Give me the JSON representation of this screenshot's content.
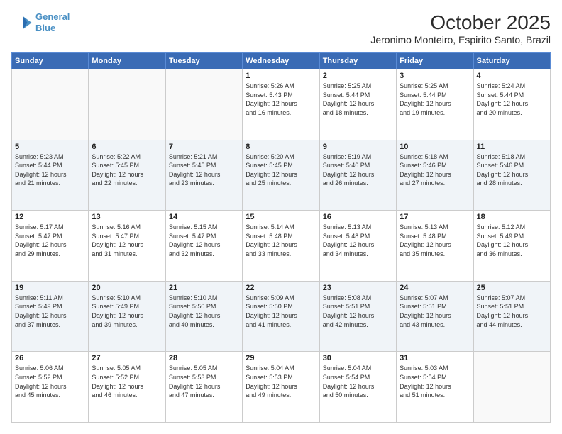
{
  "header": {
    "logo_line1": "General",
    "logo_line2": "Blue",
    "month": "October 2025",
    "location": "Jeronimo Monteiro, Espirito Santo, Brazil"
  },
  "weekdays": [
    "Sunday",
    "Monday",
    "Tuesday",
    "Wednesday",
    "Thursday",
    "Friday",
    "Saturday"
  ],
  "weeks": [
    [
      {
        "day": "",
        "info": ""
      },
      {
        "day": "",
        "info": ""
      },
      {
        "day": "",
        "info": ""
      },
      {
        "day": "1",
        "info": "Sunrise: 5:26 AM\nSunset: 5:43 PM\nDaylight: 12 hours\nand 16 minutes."
      },
      {
        "day": "2",
        "info": "Sunrise: 5:25 AM\nSunset: 5:44 PM\nDaylight: 12 hours\nand 18 minutes."
      },
      {
        "day": "3",
        "info": "Sunrise: 5:25 AM\nSunset: 5:44 PM\nDaylight: 12 hours\nand 19 minutes."
      },
      {
        "day": "4",
        "info": "Sunrise: 5:24 AM\nSunset: 5:44 PM\nDaylight: 12 hours\nand 20 minutes."
      }
    ],
    [
      {
        "day": "5",
        "info": "Sunrise: 5:23 AM\nSunset: 5:44 PM\nDaylight: 12 hours\nand 21 minutes."
      },
      {
        "day": "6",
        "info": "Sunrise: 5:22 AM\nSunset: 5:45 PM\nDaylight: 12 hours\nand 22 minutes."
      },
      {
        "day": "7",
        "info": "Sunrise: 5:21 AM\nSunset: 5:45 PM\nDaylight: 12 hours\nand 23 minutes."
      },
      {
        "day": "8",
        "info": "Sunrise: 5:20 AM\nSunset: 5:45 PM\nDaylight: 12 hours\nand 25 minutes."
      },
      {
        "day": "9",
        "info": "Sunrise: 5:19 AM\nSunset: 5:46 PM\nDaylight: 12 hours\nand 26 minutes."
      },
      {
        "day": "10",
        "info": "Sunrise: 5:18 AM\nSunset: 5:46 PM\nDaylight: 12 hours\nand 27 minutes."
      },
      {
        "day": "11",
        "info": "Sunrise: 5:18 AM\nSunset: 5:46 PM\nDaylight: 12 hours\nand 28 minutes."
      }
    ],
    [
      {
        "day": "12",
        "info": "Sunrise: 5:17 AM\nSunset: 5:47 PM\nDaylight: 12 hours\nand 29 minutes."
      },
      {
        "day": "13",
        "info": "Sunrise: 5:16 AM\nSunset: 5:47 PM\nDaylight: 12 hours\nand 31 minutes."
      },
      {
        "day": "14",
        "info": "Sunrise: 5:15 AM\nSunset: 5:47 PM\nDaylight: 12 hours\nand 32 minutes."
      },
      {
        "day": "15",
        "info": "Sunrise: 5:14 AM\nSunset: 5:48 PM\nDaylight: 12 hours\nand 33 minutes."
      },
      {
        "day": "16",
        "info": "Sunrise: 5:13 AM\nSunset: 5:48 PM\nDaylight: 12 hours\nand 34 minutes."
      },
      {
        "day": "17",
        "info": "Sunrise: 5:13 AM\nSunset: 5:48 PM\nDaylight: 12 hours\nand 35 minutes."
      },
      {
        "day": "18",
        "info": "Sunrise: 5:12 AM\nSunset: 5:49 PM\nDaylight: 12 hours\nand 36 minutes."
      }
    ],
    [
      {
        "day": "19",
        "info": "Sunrise: 5:11 AM\nSunset: 5:49 PM\nDaylight: 12 hours\nand 37 minutes."
      },
      {
        "day": "20",
        "info": "Sunrise: 5:10 AM\nSunset: 5:49 PM\nDaylight: 12 hours\nand 39 minutes."
      },
      {
        "day": "21",
        "info": "Sunrise: 5:10 AM\nSunset: 5:50 PM\nDaylight: 12 hours\nand 40 minutes."
      },
      {
        "day": "22",
        "info": "Sunrise: 5:09 AM\nSunset: 5:50 PM\nDaylight: 12 hours\nand 41 minutes."
      },
      {
        "day": "23",
        "info": "Sunrise: 5:08 AM\nSunset: 5:51 PM\nDaylight: 12 hours\nand 42 minutes."
      },
      {
        "day": "24",
        "info": "Sunrise: 5:07 AM\nSunset: 5:51 PM\nDaylight: 12 hours\nand 43 minutes."
      },
      {
        "day": "25",
        "info": "Sunrise: 5:07 AM\nSunset: 5:51 PM\nDaylight: 12 hours\nand 44 minutes."
      }
    ],
    [
      {
        "day": "26",
        "info": "Sunrise: 5:06 AM\nSunset: 5:52 PM\nDaylight: 12 hours\nand 45 minutes."
      },
      {
        "day": "27",
        "info": "Sunrise: 5:05 AM\nSunset: 5:52 PM\nDaylight: 12 hours\nand 46 minutes."
      },
      {
        "day": "28",
        "info": "Sunrise: 5:05 AM\nSunset: 5:53 PM\nDaylight: 12 hours\nand 47 minutes."
      },
      {
        "day": "29",
        "info": "Sunrise: 5:04 AM\nSunset: 5:53 PM\nDaylight: 12 hours\nand 49 minutes."
      },
      {
        "day": "30",
        "info": "Sunrise: 5:04 AM\nSunset: 5:54 PM\nDaylight: 12 hours\nand 50 minutes."
      },
      {
        "day": "31",
        "info": "Sunrise: 5:03 AM\nSunset: 5:54 PM\nDaylight: 12 hours\nand 51 minutes."
      },
      {
        "day": "",
        "info": ""
      }
    ]
  ]
}
